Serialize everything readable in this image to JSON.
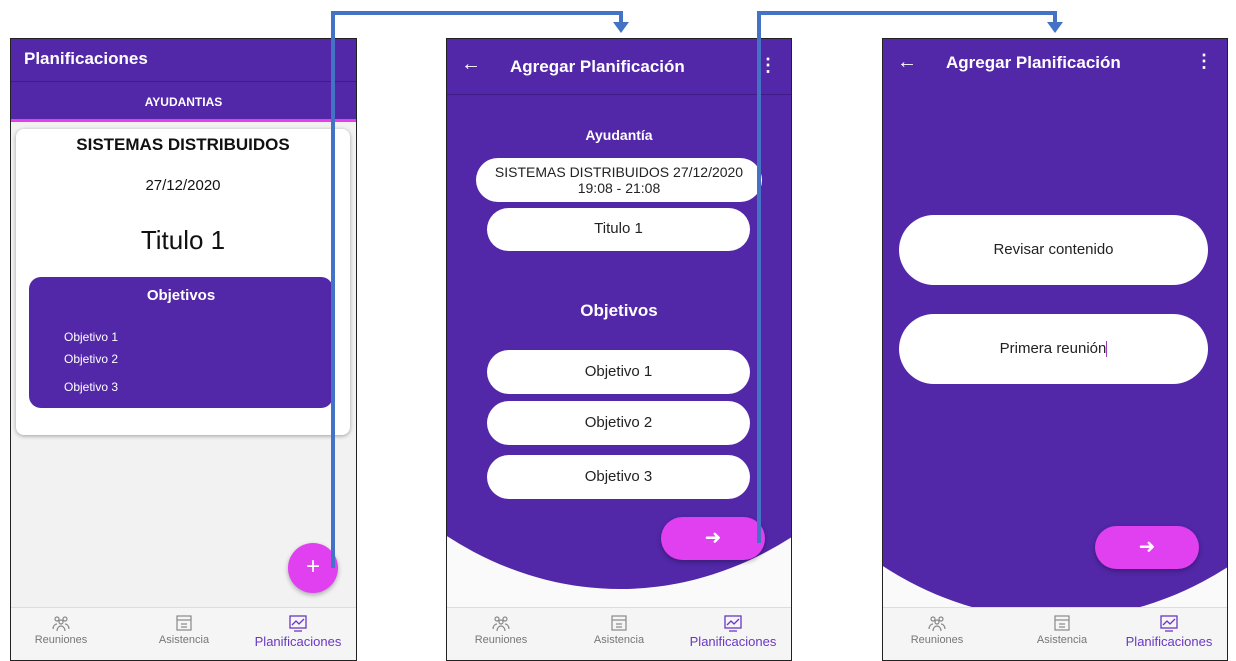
{
  "screen1": {
    "app_title": "Planificaciones",
    "tab_label": "AYUDANTIAS",
    "card": {
      "title": "SISTEMAS DISTRIBUIDOS",
      "date": "27/12/2020",
      "subtitle": "Titulo 1",
      "objectives_heading": "Objetivos",
      "objectives": [
        "Objetivo 1",
        "Objetivo 2",
        "Objetivo 3"
      ]
    },
    "fab_label": "+"
  },
  "screen2": {
    "app_title": "Agregar Planificación",
    "back_icon": "←",
    "menu_icon": "⋮",
    "ayudantia_label": "Ayudantía",
    "ayudantia_line1": "SISTEMAS DISTRIBUIDOS   27/12/2020",
    "ayudantia_line2": "19:08 - 21:08",
    "title_value": "Titulo 1",
    "objectives_heading": "Objetivos",
    "objectives": [
      "Objetivo 1",
      "Objetivo 2",
      "Objetivo 3"
    ],
    "next_icon": "➜"
  },
  "screen3": {
    "app_title": "Agregar Planificación",
    "back_icon": "←",
    "menu_icon": "⋮",
    "field1": "Revisar contenido",
    "field2": "Primera reunión",
    "next_icon": "➜"
  },
  "bottom_nav": {
    "items": [
      "Reuniones",
      "Asistencia",
      "Planificaciones"
    ],
    "active": "Planificaciones"
  },
  "colors": {
    "primary": "#5227a8",
    "accent": "#e040f0",
    "connector": "#4472c4"
  }
}
